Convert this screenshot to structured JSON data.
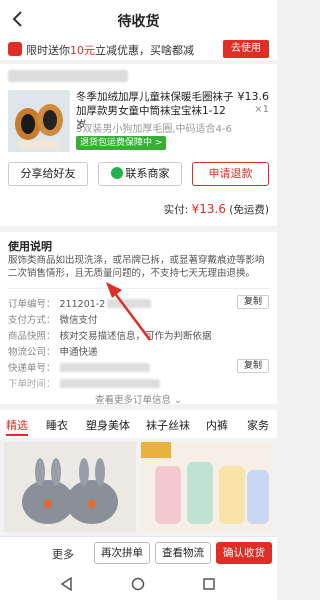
{
  "header": {
    "title": "待收货"
  },
  "promo": {
    "text_before": "限时送你",
    "highlight": "10元",
    "text_after": "立减优惠，买啥都减",
    "button": "去使用"
  },
  "order": {
    "product_title": "冬季加绒加厚儿童袜保暖毛圈袜子加厚款男女童中筒袜宝宝袜1-12岁",
    "price": "¥13.6",
    "quantity": "×1",
    "spec": "5双装男小狗加厚毛圈,中码适合4-6",
    "badge": "退货包运费保障中 >",
    "buttons": {
      "share": "分享给好友",
      "contact": "联系商家",
      "refund": "申请退款"
    },
    "paid_label": "实付:",
    "paid_amount": "¥13.6",
    "paid_note": "(免运费)"
  },
  "usage": {
    "title": "使用说明",
    "body": "服饰类商品如出现洗涤，或吊牌已拆，或显著穿戴痕迹等影响二次销售情形，且无质量问题的，不支持七天无理由退换。"
  },
  "details": {
    "order_no_label": "订单编号：",
    "order_no": "211201-2",
    "copy": "复制",
    "pay_label": "支付方式：",
    "pay_value": "微信支付",
    "snapshot_label": "商品快照：",
    "snapshot_value": "核对交易描述信息，可作为判断依据",
    "logistics_label": "物流公司：",
    "logistics_value": "申通快递",
    "tracking_label": "快递单号：",
    "order_time_label": "下单时间：",
    "more": "查看更多订单信息"
  },
  "tabs": [
    "精选",
    "睡衣",
    "塑身美体",
    "袜子丝袜",
    "内裤",
    "家务"
  ],
  "bottom_bar": {
    "more": "更多",
    "regroup": "再次拼单",
    "logistics": "查看物流",
    "confirm": "确认收货"
  },
  "colors": {
    "accent": "#e02e24",
    "green": "#35b035"
  }
}
